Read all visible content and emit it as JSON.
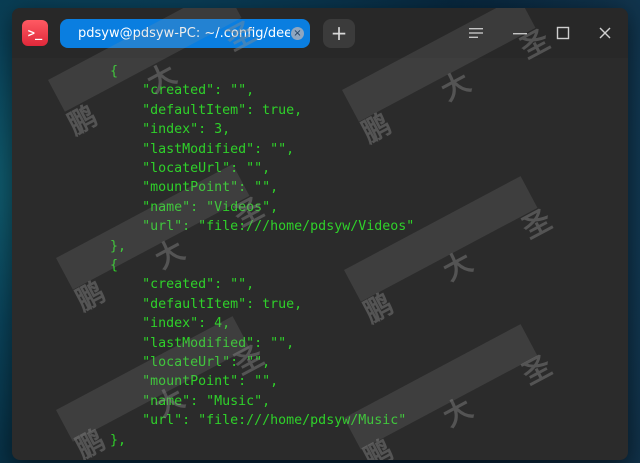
{
  "app": {
    "icon_glyph": ">_",
    "accent": "#0a7ee0"
  },
  "tab": {
    "title": "pdsyw@pdsyw-PC: ~/.config/deepin",
    "close_glyph": "×"
  },
  "add_tab_glyph": "+",
  "window_controls": {
    "menu": "☰",
    "minimize": "—",
    "maximize": "☐",
    "close": "✕"
  },
  "terminal": {
    "text_color": "#2fd12a",
    "lines": [
      "        {",
      "            \"created\": \"\",",
      "            \"defaultItem\": true,",
      "            \"index\": 3,",
      "            \"lastModified\": \"\",",
      "            \"locateUrl\": \"\",",
      "            \"mountPoint\": \"\",",
      "            \"name\": \"Videos\",",
      "            \"url\": \"file:///home/pdsyw/Videos\"",
      "        },",
      "        {",
      "            \"created\": \"\",",
      "            \"defaultItem\": true,",
      "            \"index\": 4,",
      "            \"lastModified\": \"\",",
      "            \"locateUrl\": \"\",",
      "            \"mountPoint\": \"\",",
      "            \"name\": \"Music\",",
      "            \"url\": \"file:///home/pdsyw/Music\"",
      "        },"
    ]
  },
  "watermark_text": "鹏 大 圣"
}
